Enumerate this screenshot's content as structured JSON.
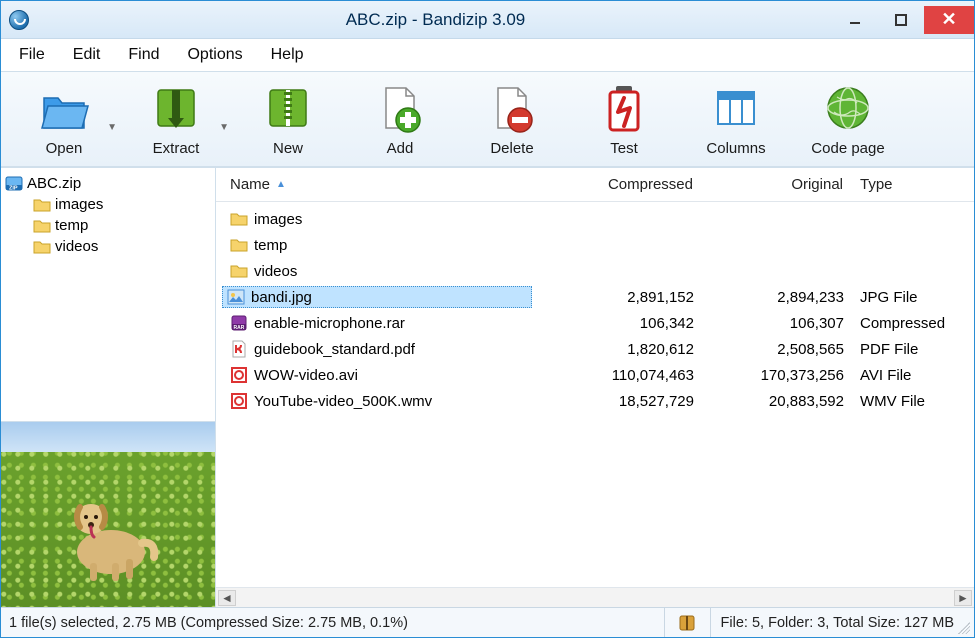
{
  "title": "ABC.zip - Bandizip 3.09",
  "menu": {
    "file": "File",
    "edit": "Edit",
    "find": "Find",
    "options": "Options",
    "help": "Help"
  },
  "toolbar": {
    "open": "Open",
    "extract": "Extract",
    "new": "New",
    "add": "Add",
    "delete": "Delete",
    "test": "Test",
    "columns": "Columns",
    "codepage": "Code page"
  },
  "tree": {
    "root": "ABC.zip",
    "children": {
      "0": "images",
      "1": "temp",
      "2": "videos"
    }
  },
  "columns_header": {
    "name": "Name",
    "compressed": "Compressed",
    "original": "Original",
    "type": "Type"
  },
  "files": {
    "0": {
      "name": "images",
      "compressed": "",
      "original": "",
      "type": ""
    },
    "1": {
      "name": "temp",
      "compressed": "",
      "original": "",
      "type": ""
    },
    "2": {
      "name": "videos",
      "compressed": "",
      "original": "",
      "type": ""
    },
    "3": {
      "name": "bandi.jpg",
      "compressed": "2,891,152",
      "original": "2,894,233",
      "type": "JPG File"
    },
    "4": {
      "name": "enable-microphone.rar",
      "compressed": "106,342",
      "original": "106,307",
      "type": "Compressed"
    },
    "5": {
      "name": "guidebook_standard.pdf",
      "compressed": "1,820,612",
      "original": "2,508,565",
      "type": "PDF File"
    },
    "6": {
      "name": "WOW-video.avi",
      "compressed": "110,074,463",
      "original": "170,373,256",
      "type": "AVI File"
    },
    "7": {
      "name": "YouTube-video_500K.wmv",
      "compressed": "18,527,729",
      "original": "20,883,592",
      "type": "WMV File"
    }
  },
  "status": {
    "left": "1 file(s) selected, 2.75 MB (Compressed Size: 2.75 MB, 0.1%)",
    "right": "File: 5, Folder: 3, Total Size: 127 MB"
  }
}
